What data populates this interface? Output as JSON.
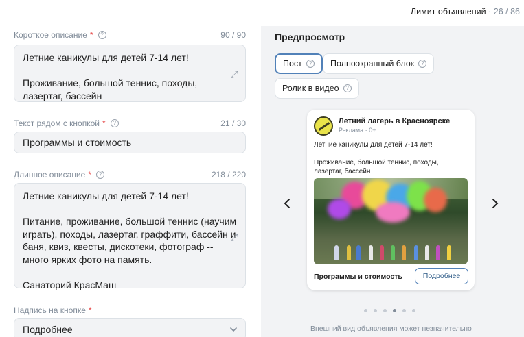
{
  "header": {
    "limit_label": "Лимит объявлений",
    "limit_count": "· 26 / 86"
  },
  "form": {
    "short_description": {
      "label": "Короткое описание",
      "required_mark": "*",
      "counter": "90 / 90",
      "value": "Летние каникулы для детей 7-14 лет!\n\nПроживание, большой теннис, походы, лазертаг, бассейн"
    },
    "button_text": {
      "label": "Текст рядом с кнопкой",
      "required_mark": "*",
      "counter": "21 / 30",
      "value": "Программы и стоимость"
    },
    "long_description": {
      "label": "Длинное описание",
      "required_mark": "*",
      "counter": "218 / 220",
      "value": "Летние каникулы для детей 7-14 лет!\n\nПитание, проживание, большой теннис (научим играть), походы, лазертаг, граффити, бассейн и баня, квиз, квесты, дискотеки, фотограф -- много ярких фото на память.\n\nСанаторий КрасМаш"
    },
    "button_caption": {
      "label": "Надпись на кнопке",
      "required_mark": "*",
      "value": "Подробнее"
    }
  },
  "preview": {
    "title": "Предпросмотр",
    "tabs": [
      {
        "label": "Пост",
        "active": true
      },
      {
        "label": "Полноэкранный блок",
        "active": false
      },
      {
        "label": "Ролик в видео",
        "active": false
      }
    ],
    "card": {
      "name": "Летний лагерь в Красноярске",
      "sub": "Реклама · 0+",
      "text_line1": "Летние каникулы для детей 7-14 лет!",
      "text_line2": "Проживание, большой теннис, походы, лазертаг, бассейн",
      "button_text": "Программы и стоимость",
      "button_label": "Подробнее"
    },
    "prev_icon": "chevron-left-icon",
    "next_icon": "chevron-right-icon",
    "dots_total": 6,
    "dots_active_index": 3,
    "footnote": "Внешний вид объявления может незначительно"
  },
  "colors": {
    "accent": "#5181b8",
    "required": "#e64646",
    "muted": "#818c99",
    "preview_bg": "#f2f3f5"
  }
}
